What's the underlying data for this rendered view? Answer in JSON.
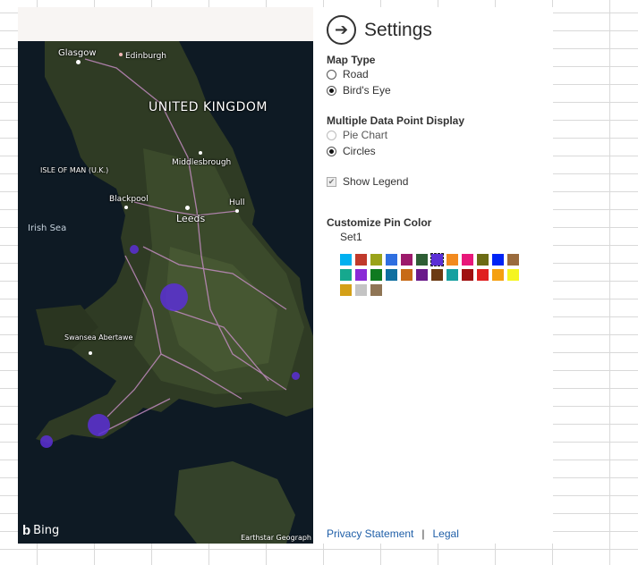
{
  "map": {
    "labels": {
      "glasgow": "Glasgow",
      "edinburgh": "Edinburgh",
      "country": "UNITED KINGDOM",
      "middlesbrough": "Middlesbrough",
      "isle_of_man": "ISLE OF MAN (U.K.)",
      "blackpool": "Blackpool",
      "leeds": "Leeds",
      "hull": "Hull",
      "irish_sea": "Irish Sea",
      "swansea": "Swansea Abertawe"
    },
    "pins_color": "#5b2fd6",
    "bing_label": "Bing",
    "copyright": "Earthstar Geograph"
  },
  "settings": {
    "title": "Settings",
    "map_type": {
      "label": "Map Type",
      "options": [
        "Road",
        "Bird's Eye"
      ],
      "selected": "Bird's Eye"
    },
    "multi_point": {
      "label": "Multiple Data Point Display",
      "options": [
        "Pie Chart",
        "Circles"
      ],
      "selected": "Circles"
    },
    "show_legend": {
      "label": "Show Legend",
      "checked": true
    },
    "pin_color": {
      "label": "Customize Pin Color",
      "set_label": "Set1",
      "selected_index": 6,
      "colors": [
        "#00b0f0",
        "#c0392b",
        "#9aa31a",
        "#2f6fe0",
        "#9c1a6b",
        "#2e5e35",
        "#5b2fd6",
        "#f28a1e",
        "#e8187a",
        "#6b6b14",
        "#0024f5",
        "#9a6b3d",
        "#16a88e",
        "#8a2bd6",
        "#0f7a20",
        "#0f6fa0",
        "#c76a16",
        "#6a1a8a",
        "#6b3a12",
        "#16a0a0",
        "#a01010",
        "#e02020",
        "#f5a010",
        "#f5f520",
        "#d4a018",
        "#c4c4c4",
        "#8f7555"
      ]
    },
    "footer": {
      "privacy": "Privacy Statement",
      "separator": "|",
      "legal": "Legal"
    }
  }
}
